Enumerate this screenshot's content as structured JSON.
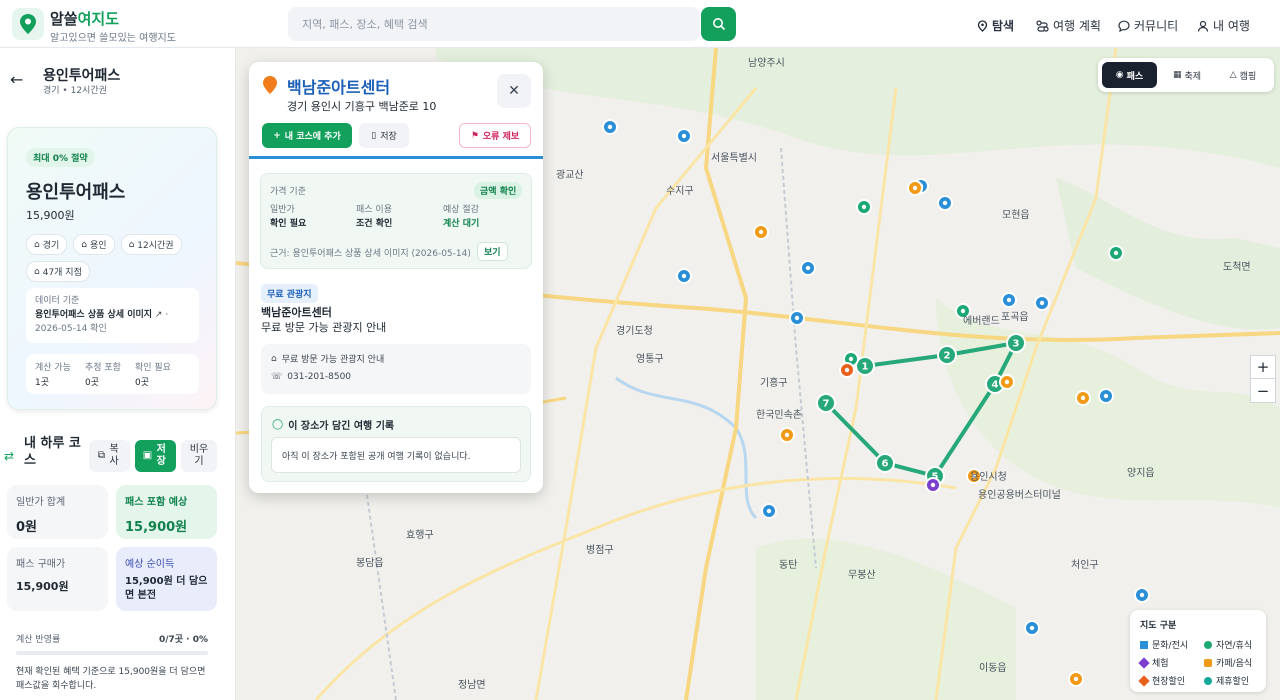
{
  "app": {
    "brand_prefix": "알쓸",
    "brand_accent": "여지도",
    "tagline": "알고있으면 쓸모있는 여행지도",
    "brand_color": "#12a05c"
  },
  "search": {
    "placeholder": "지역, 패스, 장소, 혜택 검색"
  },
  "nav": {
    "explore": "탐색",
    "plan": "여행 계획",
    "community": "커뮤니티",
    "my_trip": "내 여행"
  },
  "sidebar": {
    "title": "용인투어패스",
    "subtitle": "경기 • 12시간권",
    "card": {
      "save_chip": "최대 0% 절약",
      "title": "용인투어패스",
      "price": "15,900원",
      "tags": [
        "경기",
        "용인",
        "12시간권",
        "47개 지점"
      ],
      "source_label": "데이터 기준",
      "source_link": "용인투어패스 상품 상세 이미지",
      "source_date": "2026-05-14 확인",
      "stats": [
        {
          "label": "계산 가능",
          "value": "1곳"
        },
        {
          "label": "추정 포함",
          "value": "0곳"
        },
        {
          "label": "확인 필요",
          "value": "0곳"
        }
      ]
    },
    "course": {
      "title": "내 하루 코스",
      "copy": "복사",
      "save": "저장",
      "clear": "비우기"
    },
    "summary": [
      {
        "label": "일반가 합계",
        "value": "0원"
      },
      {
        "label": "패스 포함 예상",
        "value": "15,900원"
      },
      {
        "label": "패스 구매가",
        "value": "15,900원"
      },
      {
        "label": "예상 순이득",
        "value": "15,900원 더 담으면 본전"
      }
    ],
    "progress": {
      "label": "계산 반영률",
      "value": "0/7곳 · 0%",
      "ratio": 0,
      "note": "현재 확인된 혜택 기준으로 15,900원을 더 담으면 패스값을 회수합니다."
    }
  },
  "popup": {
    "name": "백남준아트센터",
    "address": "경기 용인시 기흥구 백남준로 10",
    "add_course": "내 코스에 추가",
    "save": "저장",
    "report": "오류 제보",
    "price_title": "가격 기준",
    "price_badge": "금액 확인",
    "cols": [
      {
        "label": "일반가",
        "value": "확인 필요"
      },
      {
        "label": "패스 이용",
        "value": "조건 확인"
      },
      {
        "label": "예상 절감",
        "value": "계산 대기"
      }
    ],
    "basis": "근거: 용인투어패스 상품 상세 이미지 (2026-05-14)",
    "basis_btn": "보기",
    "free_badge": "무료 관광지",
    "free_name": "백남준아트센터",
    "free_desc": "무료 방문 가능 관광지 안내",
    "info_text": "무료 방문 가능 관광지 안내",
    "phone": "031-201-8500",
    "record_title": "이 장소가 담긴 여행 기록",
    "record_empty": "아직 이 장소가 포함된 공개 여행 기록이 없습니다."
  },
  "map": {
    "filters": {
      "pass": "패스",
      "festival": "축제",
      "camping": "캠핑"
    },
    "zoom_in": "+",
    "zoom_out": "−",
    "route_numbers": [
      "1",
      "2",
      "3",
      "4",
      "5",
      "6",
      "7"
    ],
    "labels": [
      {
        "t": "남양주시"
      },
      {
        "t": "서울특별시"
      },
      {
        "t": "수지구"
      },
      {
        "t": "모현읍"
      },
      {
        "t": "도척면"
      },
      {
        "t": "포곡읍"
      },
      {
        "t": "에버랜드"
      },
      {
        "t": "영통구"
      },
      {
        "t": "기흥구"
      },
      {
        "t": "한국민속촌"
      },
      {
        "t": "처인구"
      },
      {
        "t": "양지읍"
      },
      {
        "t": "용인공용버스터미널"
      },
      {
        "t": "효행구"
      },
      {
        "t": "병점구"
      },
      {
        "t": "동탄"
      },
      {
        "t": "이동읍"
      },
      {
        "t": "정남면"
      },
      {
        "t": "봉담읍"
      },
      {
        "t": "광교산"
      },
      {
        "t": "경기도청"
      },
      {
        "t": "무봉산"
      },
      {
        "t": "용인시청"
      }
    ],
    "legend": {
      "title": "지도 구분",
      "items": [
        {
          "label": "문화/전시",
          "color": "#2a8fd6"
        },
        {
          "label": "자연/휴식",
          "color": "#1aa874"
        },
        {
          "label": "체험",
          "color": "#7b3fd0"
        },
        {
          "label": "카페/음식",
          "color": "#f29a16"
        },
        {
          "label": "현장할인",
          "color": "#e8611c"
        },
        {
          "label": "제휴할인",
          "color": "#12a89c"
        }
      ]
    }
  }
}
